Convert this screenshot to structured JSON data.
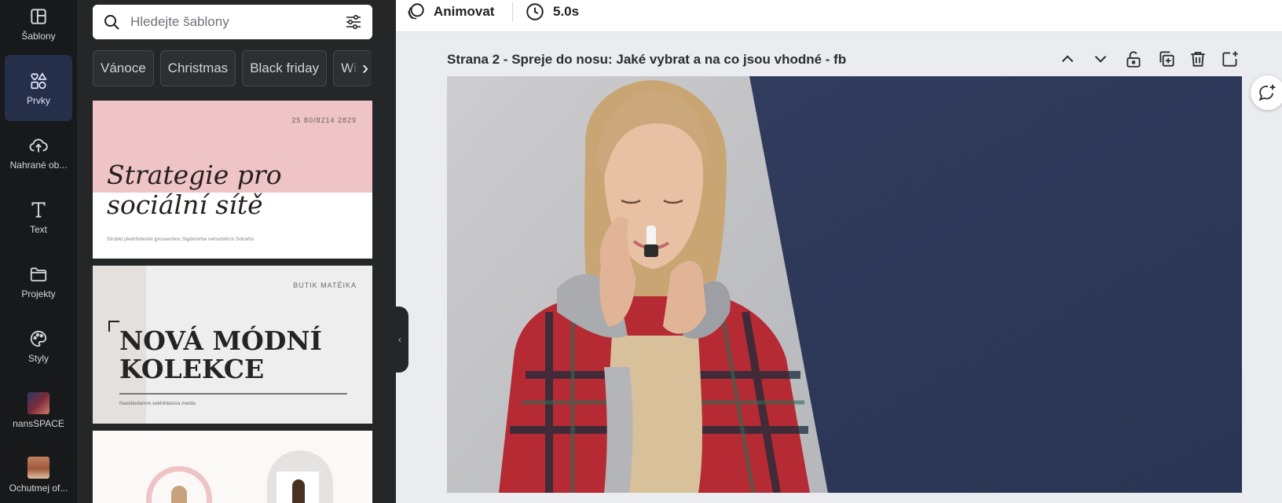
{
  "rail": {
    "items": [
      {
        "label": "Šablony",
        "icon": "layout-icon"
      },
      {
        "label": "Prvky",
        "icon": "shapes-icon",
        "active": true
      },
      {
        "label": "Nahrané ob...",
        "icon": "cloud-upload-icon"
      },
      {
        "label": "Text",
        "icon": "text-icon"
      },
      {
        "label": "Projekty",
        "icon": "folder-icon"
      },
      {
        "label": "Styly",
        "icon": "palette-icon"
      },
      {
        "label": "nansSPACE",
        "icon": "app-thumbnail-icon"
      },
      {
        "label": "Ochutmej of...",
        "icon": "app-thumbnail-icon"
      }
    ]
  },
  "panel": {
    "search": {
      "placeholder": "Hledejte šablony"
    },
    "chips": [
      "Vánoce",
      "Christmas",
      "Black friday",
      "Win"
    ],
    "templates": [
      {
        "date": "25 80/8214 2829",
        "title_line1": "Strategie pro",
        "title_line2": "sociální sítě",
        "subtitle": "Strubki pledrhidestie jpcouenboc Sigdomrbe nehsdsticrn Solcehs"
      },
      {
        "brand": "BUTIK MATĚIKA",
        "title_line1": "NOVÁ MÓDNÍ",
        "title_line2": "KOLEKCE",
        "subtitle": "Nasldiedamre sekhihlasiva melda"
      },
      {}
    ]
  },
  "topbar": {
    "animate_label": "Animovat",
    "duration_label": "5.0s"
  },
  "page": {
    "title": "Strana 2 - Spreje do nosu: Jaké vybrat a na co jsou vhodné - fb"
  },
  "colors": {
    "accent": "#252f4a",
    "canvas_navy": "#2f3a5c",
    "template_pink": "#eec4c6",
    "panel_bg": "#252627",
    "rail_bg": "#18191b"
  }
}
